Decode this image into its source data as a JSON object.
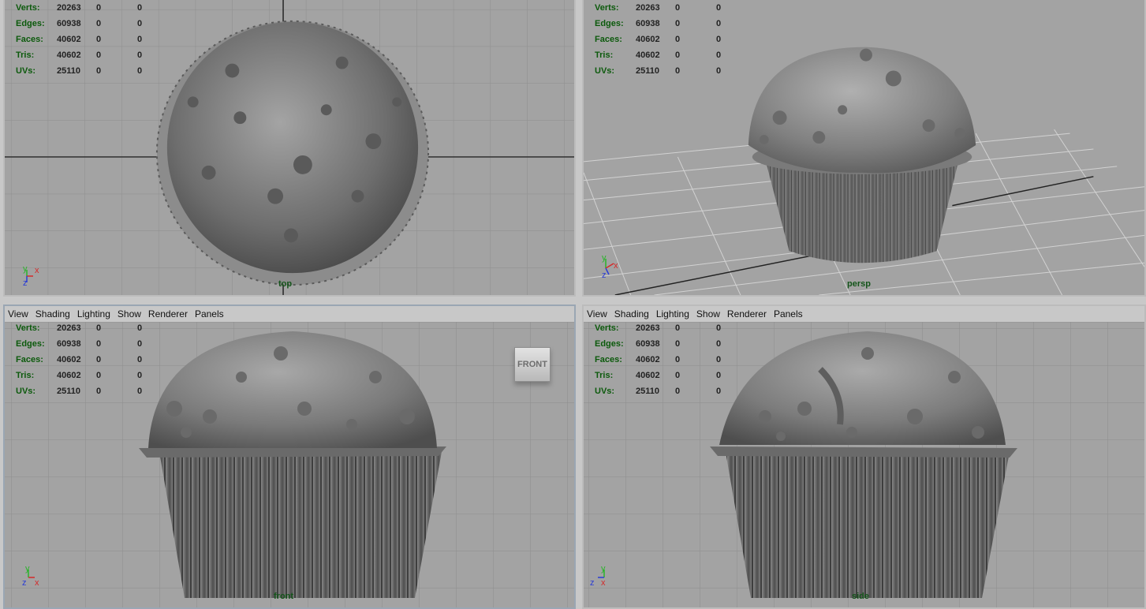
{
  "menu": [
    "View",
    "Shading",
    "Lighting",
    "Show",
    "Renderer",
    "Panels"
  ],
  "stats": [
    {
      "label": "Verts:",
      "v1": "20263",
      "v2": "0",
      "v3": "0"
    },
    {
      "label": "Edges:",
      "v1": "60938",
      "v2": "0",
      "v3": "0"
    },
    {
      "label": "Faces:",
      "v1": "40602",
      "v2": "0",
      "v3": "0"
    },
    {
      "label": "Tris:",
      "v1": "40602",
      "v2": "0",
      "v3": "0"
    },
    {
      "label": "UVs:",
      "v1": "25110",
      "v2": "0",
      "v3": "0"
    }
  ],
  "viewports": {
    "top": {
      "camera": "top",
      "axis_a": "y",
      "axis_b": "x",
      "axis_c": "z"
    },
    "persp": {
      "camera": "persp",
      "axis_a": "y",
      "axis_b": "x",
      "axis_c": "z"
    },
    "front": {
      "camera": "front",
      "axis_a": "y",
      "axis_b": "x",
      "axis_c": "z",
      "viewcube": "FRONT"
    },
    "side": {
      "camera": "side",
      "axis_a": "y",
      "axis_b": "x",
      "axis_c": "z"
    }
  },
  "colors": {
    "viewport_bg": "#a3a3a3",
    "grid": "#8e8e8e",
    "hud_label": "#0c5a0c",
    "axis_x": "#d42a2a",
    "axis_y": "#2ab42a",
    "axis_z": "#2a3cd4"
  }
}
